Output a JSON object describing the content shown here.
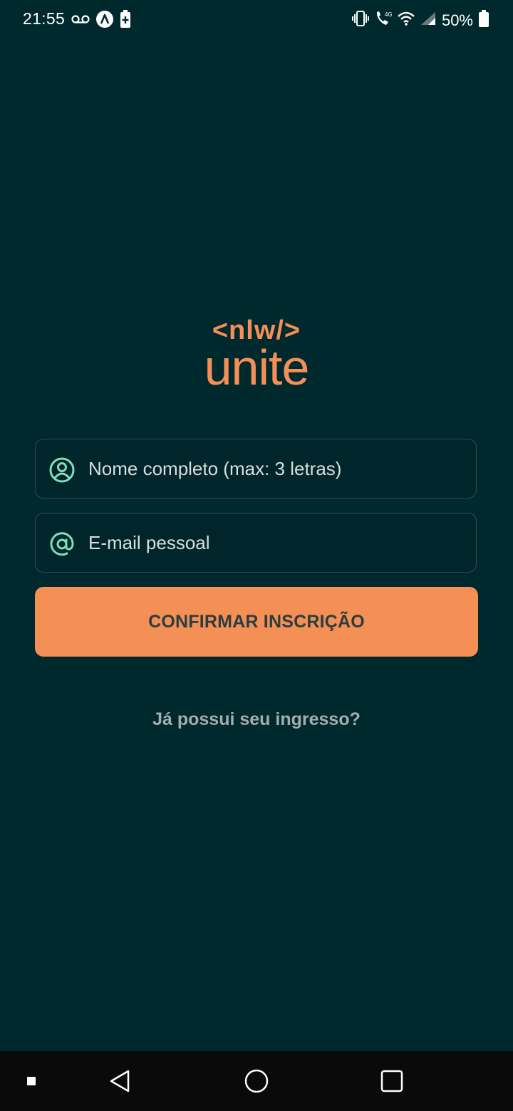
{
  "status_bar": {
    "time": "21:55",
    "battery_percent": "50%",
    "left_icons": [
      "voicemail-icon",
      "app-a-icon",
      "battery-saver-icon"
    ],
    "right_icons": [
      "vibrate-icon",
      "volte-4g-call-icon",
      "wifi-icon",
      "cell-signal-icon",
      "battery-icon"
    ],
    "network_badge": "4G"
  },
  "logo": {
    "top_text": "<nlw/>",
    "main_text": "unite",
    "color": "#f48f56"
  },
  "form": {
    "name_field": {
      "placeholder": "Nome completo (max: 3 letras)",
      "value": "",
      "icon": "user-circle-icon"
    },
    "email_field": {
      "placeholder": "E-mail pessoal",
      "value": "",
      "icon": "at-sign-icon"
    },
    "confirm_label": "CONFIRMAR INSCRIÇÃO",
    "ticket_link": "Já possui seu ingresso?"
  },
  "nav_bar": {
    "items": [
      "square-dot-icon",
      "back-icon",
      "home-icon",
      "recents-icon"
    ]
  },
  "colors": {
    "background": "#00292e",
    "accent": "#f48f56",
    "icon_green": "#7ee0b8",
    "field_border": "#2a4f53"
  }
}
